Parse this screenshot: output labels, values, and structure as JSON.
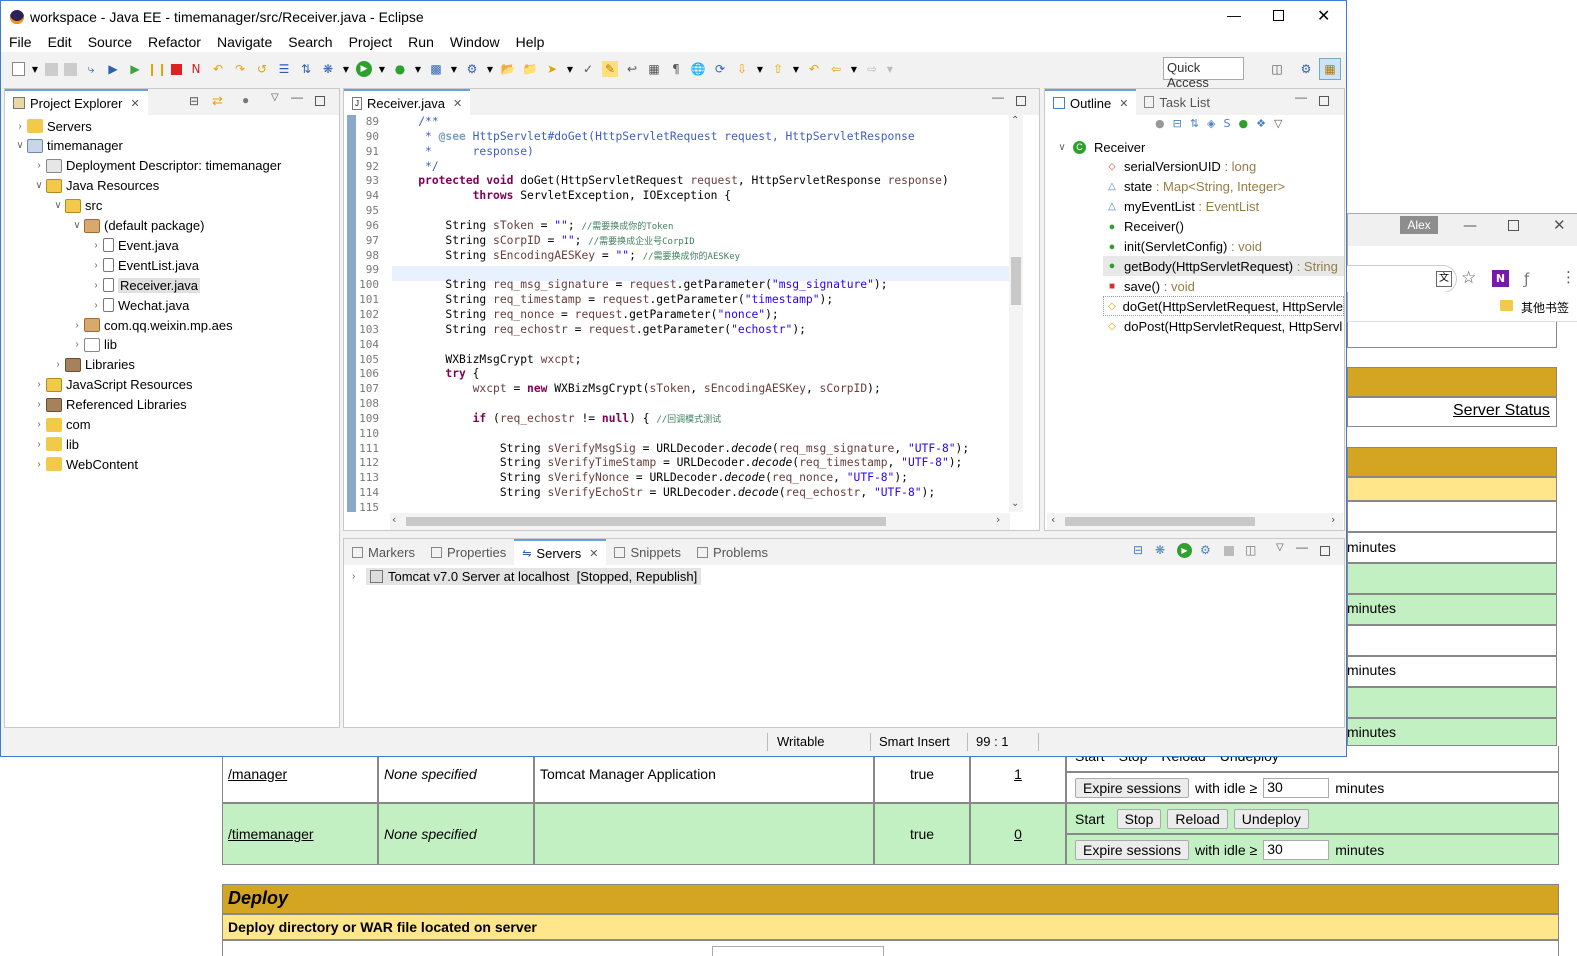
{
  "browser": {
    "profile_name": "Alex",
    "bookmarks_label": "其他书签",
    "server_status_link": "Server Status",
    "minutes_label": "minutes",
    "apps": [
      {
        "path": "/manager",
        "version": "None specified",
        "display_name": "Tomcat Manager Application",
        "running": "true",
        "sessions": "1",
        "actions": [
          "Start",
          "Stop",
          "Reload",
          "Undeploy"
        ],
        "idle_value": "30"
      },
      {
        "path": "/timemanager",
        "version": "None specified",
        "display_name": "",
        "running": "true",
        "sessions": "0",
        "actions": [
          "Start",
          "Stop",
          "Reload",
          "Undeploy"
        ],
        "idle_value": "30"
      }
    ],
    "expire_label": "Expire sessions",
    "with_idle_label": "with idle ≥",
    "deploy_heading": "Deploy",
    "deploy_subheading": "Deploy directory or WAR file located on server",
    "colors": {
      "header_gold": "#d4a520",
      "row_green": "#c3f0c3",
      "light_yellow": "#ffe68a"
    }
  },
  "eclipse": {
    "title": "workspace - Java EE - timemanager/src/Receiver.java - Eclipse",
    "menu": [
      "File",
      "Edit",
      "Source",
      "Refactor",
      "Navigate",
      "Search",
      "Project",
      "Run",
      "Window",
      "Help"
    ],
    "quick_access": "Quick Access",
    "project_explorer": {
      "tab": "Project Explorer",
      "items": [
        {
          "label": "Servers",
          "level": 0,
          "twisty": ">",
          "icon": "folder"
        },
        {
          "label": "timemanager",
          "level": 0,
          "twisty": "v",
          "icon": "project"
        },
        {
          "label": "Deployment Descriptor: timemanager",
          "level": 1,
          "twisty": ">",
          "icon": "descriptor"
        },
        {
          "label": "Java Resources",
          "level": 1,
          "twisty": "v",
          "icon": "javares"
        },
        {
          "label": "src",
          "level": 2,
          "twisty": "v",
          "icon": "srcfolder"
        },
        {
          "label": "(default package)",
          "level": 3,
          "twisty": "v",
          "icon": "package"
        },
        {
          "label": "Event.java",
          "level": 4,
          "twisty": ">",
          "icon": "java"
        },
        {
          "label": "EventList.java",
          "level": 4,
          "twisty": ">",
          "icon": "java"
        },
        {
          "label": "Receiver.java",
          "level": 4,
          "twisty": ">",
          "icon": "java"
        },
        {
          "label": "Wechat.java",
          "level": 4,
          "twisty": ">",
          "icon": "java"
        },
        {
          "label": "com.qq.weixin.mp.aes",
          "level": 3,
          "twisty": ">",
          "icon": "package"
        },
        {
          "label": "lib",
          "level": 3,
          "twisty": ">",
          "icon": "package-empty"
        },
        {
          "label": "Libraries",
          "level": 2,
          "twisty": ">",
          "icon": "libraries"
        },
        {
          "label": "JavaScript Resources",
          "level": 1,
          "twisty": ">",
          "icon": "jsres"
        },
        {
          "label": "Referenced Libraries",
          "level": 1,
          "twisty": ">",
          "icon": "libraries"
        },
        {
          "label": "com",
          "level": 1,
          "twisty": ">",
          "icon": "folder"
        },
        {
          "label": "lib",
          "level": 1,
          "twisty": ">",
          "icon": "folder"
        },
        {
          "label": "WebContent",
          "level": 1,
          "twisty": ">",
          "icon": "folder"
        }
      ]
    },
    "editor": {
      "tab": "Receiver.java",
      "line_numbers": [
        "89",
        "90",
        "91",
        "92",
        "93",
        "94",
        "95",
        "96",
        "97",
        "98",
        "99",
        "100",
        "101",
        "102",
        "103",
        "104",
        "105",
        "106",
        "107",
        "108",
        "109",
        "110",
        "111",
        "112",
        "113",
        "114",
        "115"
      ]
    },
    "outline": {
      "tab": "Outline",
      "task_tab": "Task List",
      "root": "Receiver",
      "items": [
        {
          "name": "serialVersionUID",
          "type": " : long",
          "icon": "field-static"
        },
        {
          "name": "state",
          "type": " : Map<String, Integer>",
          "icon": "field-default"
        },
        {
          "name": "myEventList",
          "type": " : EventList",
          "icon": "field-default"
        },
        {
          "name": "Receiver()",
          "type": "",
          "icon": "constructor"
        },
        {
          "name": "init(ServletConfig)",
          "type": " : void",
          "icon": "method-public"
        },
        {
          "name": "getBody(HttpServletRequest)",
          "type": " : String",
          "icon": "method-public"
        },
        {
          "name": "save()",
          "type": " : void",
          "icon": "method-private"
        },
        {
          "name": "doGet(HttpServletRequest, HttpServle",
          "type": "",
          "icon": "method-protected"
        },
        {
          "name": "doPost(HttpServletRequest, HttpServl",
          "type": "",
          "icon": "method-protected"
        }
      ]
    },
    "bottom": {
      "tabs": [
        "Markers",
        "Properties",
        "Servers",
        "Snippets",
        "Problems"
      ],
      "active": "Servers",
      "server_entry": "Tomcat v7.0 Server at localhost  [Stopped, Republish]"
    },
    "status": {
      "writable": "Writable",
      "insert_mode": "Smart Insert",
      "position": "99 : 1"
    }
  }
}
